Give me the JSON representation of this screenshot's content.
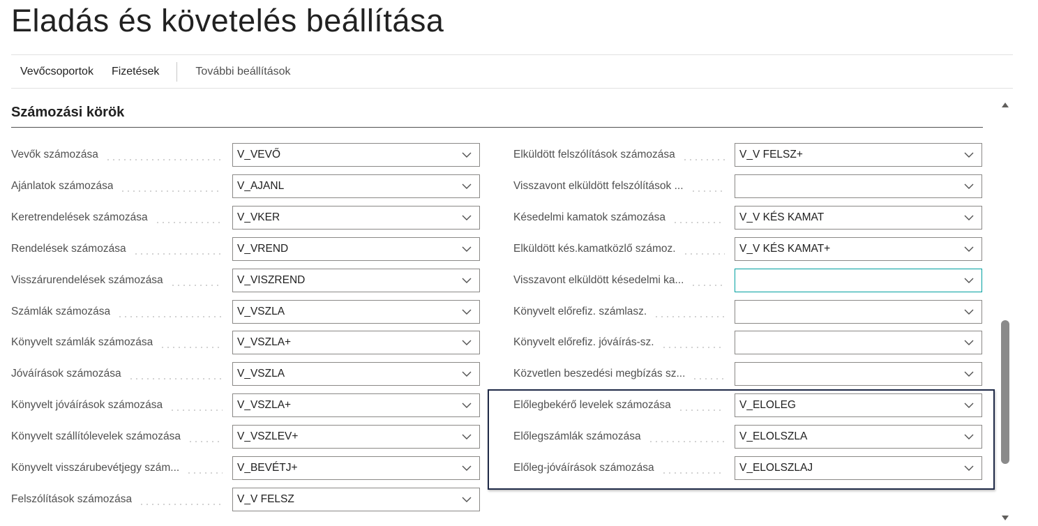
{
  "page": {
    "title": "Eladás és követelés beállítása"
  },
  "actions": {
    "customer_groups": "Vevőcsoportok",
    "payments": "Fizetések",
    "more_settings": "További beállítások"
  },
  "section": {
    "title": "Számozási körök"
  },
  "left_fields": [
    {
      "label": "Vevők számozása",
      "value": "V_VEVŐ"
    },
    {
      "label": "Ajánlatok számozása",
      "value": "V_AJANL"
    },
    {
      "label": "Keretrendelések számozása",
      "value": "V_VKER"
    },
    {
      "label": "Rendelések számozása",
      "value": "V_VREND"
    },
    {
      "label": "Visszárurendelések számozása",
      "value": "V_VISZREND"
    },
    {
      "label": "Számlák számozása",
      "value": "V_VSZLA"
    },
    {
      "label": "Könyvelt számlák számozása",
      "value": "V_VSZLA+"
    },
    {
      "label": "Jóváírások számozása",
      "value": "V_VSZLA"
    },
    {
      "label": "Könyvelt jóváírások számozása",
      "value": "V_VSZLA+"
    },
    {
      "label": "Könyvelt szállítólevelek számozása",
      "value": "V_VSZLEV+"
    },
    {
      "label": "Könyvelt visszárubevétjegy szám...",
      "value": "V_BEVÉTJ+"
    },
    {
      "label": "Felszólítások számozása",
      "value": "V_V FELSZ"
    }
  ],
  "right_fields": [
    {
      "label": "Elküldött felszólítások számozása",
      "value": "V_V FELSZ+"
    },
    {
      "label": "Visszavont elküldött felszólítások ...",
      "value": ""
    },
    {
      "label": "Késedelmi kamatok számozása",
      "value": "V_V KÉS KAMAT"
    },
    {
      "label": "Elküldött kés.kamatközlő számoz.",
      "value": "V_V KÉS KAMAT+"
    },
    {
      "label": "Visszavont elküldött késedelmi ka...",
      "value": ""
    },
    {
      "label": "Könyvelt előrefiz. számlasz.",
      "value": ""
    },
    {
      "label": "Könyvelt előrefiz. jóváírás-sz.",
      "value": ""
    },
    {
      "label": "Közvetlen beszedési megbízás sz...",
      "value": ""
    },
    {
      "label": "Előlegbekérő levelek számozása",
      "value": "V_ELOLEG"
    },
    {
      "label": "Előlegszámlák számozása",
      "value": "V_ELOLSZLA"
    },
    {
      "label": "Előleg-jóváírások számozása",
      "value": "V_ELOLSZLAJ"
    }
  ],
  "colors": {
    "highlight_border": "#1f2a47",
    "focused_input_border": "#00a0a0",
    "input_border": "#8a8886",
    "label_text": "#505050"
  },
  "icons": {
    "dropdown": "chevron-down-icon",
    "scroll_up": "scroll-up-arrow-icon",
    "scroll_down": "scroll-down-arrow-icon"
  }
}
